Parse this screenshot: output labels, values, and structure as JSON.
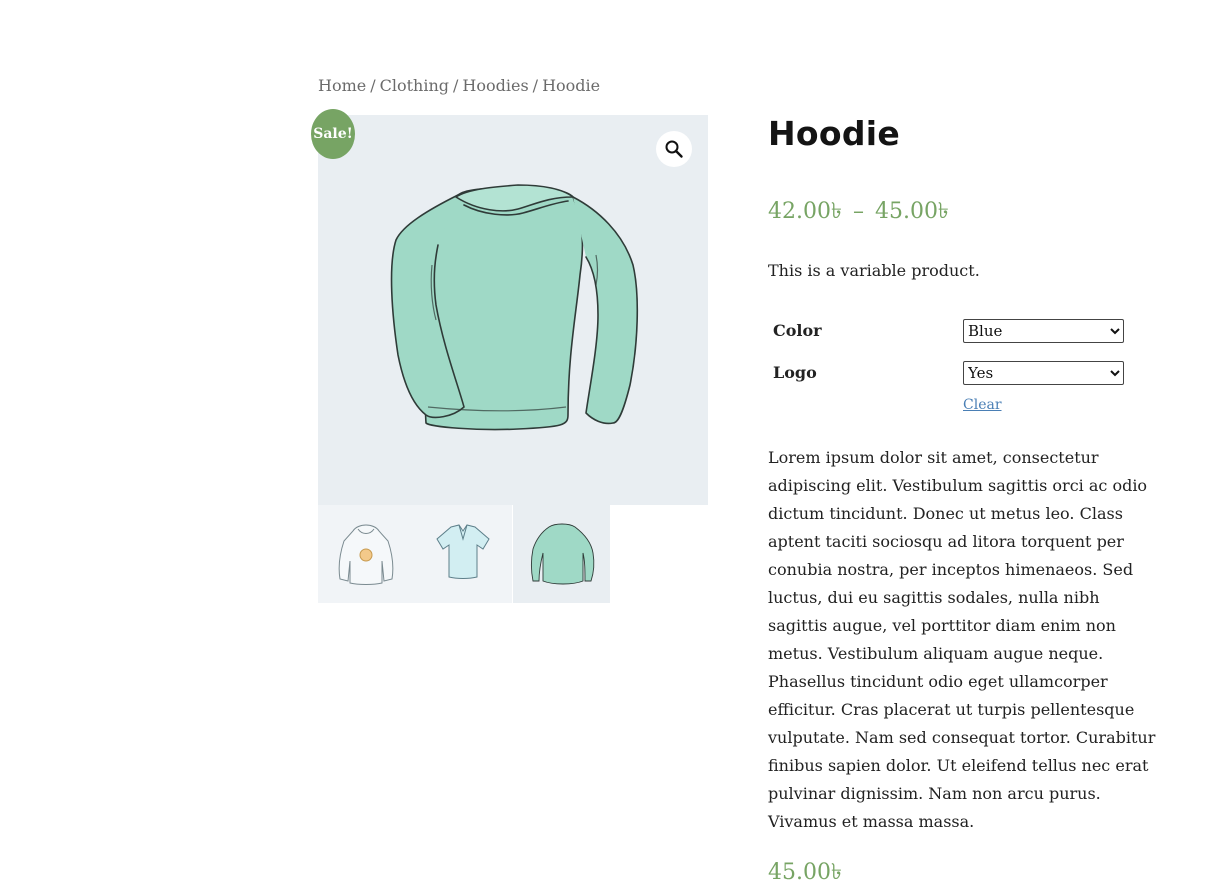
{
  "breadcrumb": {
    "items": [
      "Home",
      "Clothing",
      "Hoodies"
    ],
    "current": "Hoodie",
    "separator": "/"
  },
  "gallery": {
    "sale_badge": "Sale!",
    "zoom_icon": "magnifier-icon",
    "thumbnails": [
      "hoodie-with-logo",
      "polo-shirt",
      "long-sleeve-tee"
    ],
    "active_thumbnail_index": 2
  },
  "product": {
    "title": "Hoodie",
    "price_min": "42.00৳",
    "price_sep": "–",
    "price_max": "45.00৳",
    "short_description": "This is a variable product.",
    "variations": [
      {
        "label": "Color",
        "selected": "Blue"
      },
      {
        "label": "Logo",
        "selected": "Yes"
      }
    ],
    "clear_label": "Clear",
    "description": "Lorem ipsum dolor sit amet, consectetur adipiscing elit. Vestibulum sagittis orci ac odio dictum tincidunt. Donec ut metus leo. Class aptent taciti sociosqu ad litora torquent per conubia nostra, per inceptos himenaeos. Sed luctus, dui eu sagittis sodales, nulla nibh sagittis augue, vel porttitor diam enim non metus. Vestibulum aliquam augue neque. Phasellus tincidunt odio eget ullamcorper efficitur. Cras placerat ut turpis pellentesque vulputate. Nam sed consequat tortor. Curabitur finibus sapien dolor. Ut eleifend tellus nec erat pulvinar dignissim. Nam non arcu purus. Vivamus et massa massa.",
    "variation_price": "45.00৳"
  },
  "colors": {
    "accent_green": "#77a464",
    "link_blue": "#4a7fb5",
    "image_bg": "#e9eef2",
    "sweater_fill": "#9fd9c6"
  }
}
